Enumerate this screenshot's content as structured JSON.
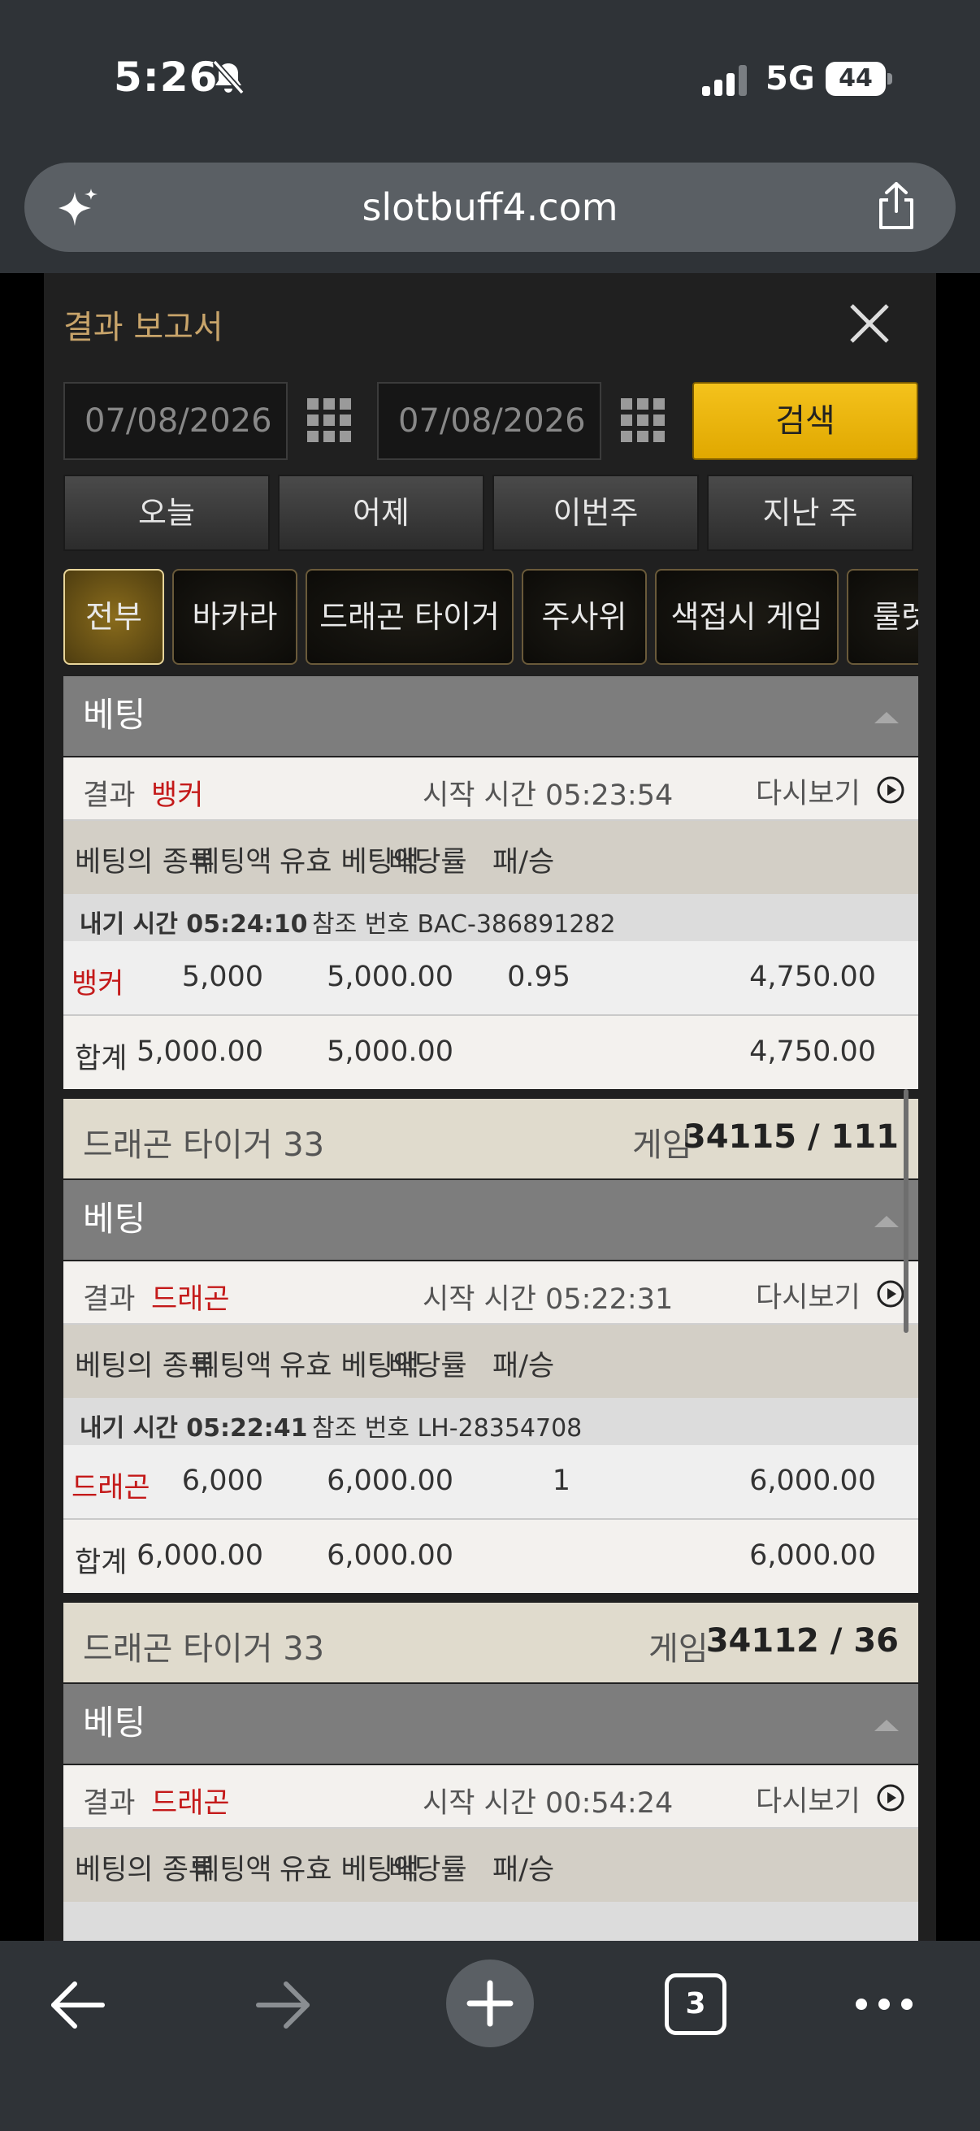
{
  "status_bar": {
    "time": "5:26",
    "network": "5G",
    "battery": "44",
    "icons": [
      "bell-off-icon",
      "signal-icon",
      "battery-icon"
    ]
  },
  "browser": {
    "url": "slotbuff4.com",
    "tab_count": "3",
    "icons": [
      "sparkle-icon",
      "share-icon",
      "back-icon",
      "forward-icon",
      "new-tab-icon",
      "tabs-icon",
      "more-icon"
    ]
  },
  "panel": {
    "title": "결과 보고서",
    "date_from": "07/08/2026",
    "date_to": "07/08/2026",
    "search_label": "검색",
    "quick_ranges": [
      "오늘",
      "어제",
      "이번주",
      "지난 주"
    ],
    "tabs": [
      "전부",
      "바카라",
      "드래곤 타이거",
      "주사위",
      "색접시 게임",
      "룰렛"
    ],
    "active_tab": "전부"
  },
  "columns": [
    "베팅의 종류",
    "베팅액",
    "유효 베팅액",
    "배당률",
    "패/승"
  ],
  "labels": {
    "bet_header": "베팅",
    "result_label": "결과",
    "replay": "다시보기",
    "total": "합계",
    "game_label": "게임"
  },
  "sections": [
    {
      "game_name": "",
      "game_number": "",
      "result": "뱅커",
      "start_time": "시작 시간 05:23:54",
      "bet_time": "내기 시간 05:24:10",
      "reference": "참조 번호 BAC-386891282",
      "row": {
        "type": "뱅커",
        "amount": "5,000",
        "valid": "5,000.00",
        "odds": "0.95",
        "winloss": "4,750.00"
      },
      "total": {
        "amount": "5,000.00",
        "valid": "5,000.00",
        "winloss": "4,750.00"
      }
    },
    {
      "game_name": "드래곤 타이거 33",
      "game_number": "34115 / 111",
      "result": "드래곤",
      "start_time": "시작 시간 05:22:31",
      "bet_time": "내기 시간 05:22:41",
      "reference": "참조 번호 LH-28354708",
      "row": {
        "type": "드래곤",
        "amount": "6,000",
        "valid": "6,000.00",
        "odds": "1",
        "winloss": "6,000.00"
      },
      "total": {
        "amount": "6,000.00",
        "valid": "6,000.00",
        "winloss": "6,000.00"
      }
    },
    {
      "game_name": "드래곤 타이거 33",
      "game_number": "34112 / 36",
      "result": "드래곤",
      "start_time": "시작 시간 00:54:24"
    }
  ]
}
